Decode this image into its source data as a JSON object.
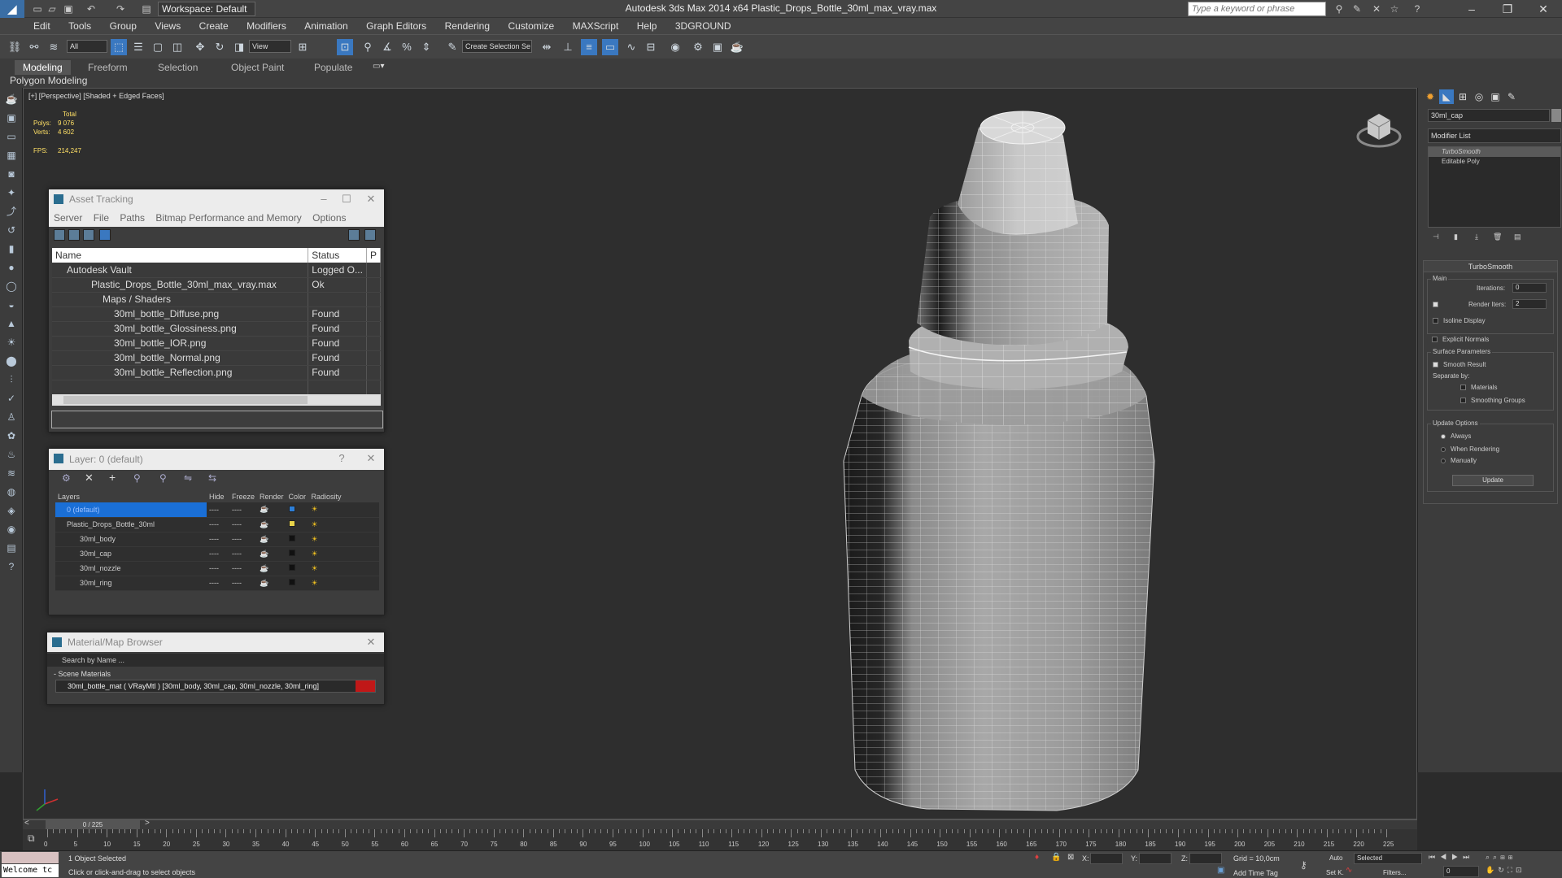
{
  "app": {
    "title": "Autodesk 3ds Max  2014 x64     Plastic_Drops_Bottle_30ml_max_vray.max",
    "workspace": "Workspace: Default",
    "search_placeholder": "Type a keyword or phrase"
  },
  "menu": [
    "Edit",
    "Tools",
    "Group",
    "Views",
    "Create",
    "Modifiers",
    "Animation",
    "Graph Editors",
    "Rendering",
    "Customize",
    "MAXScript",
    "Help",
    "3DGROUND"
  ],
  "toolbar": {
    "filter": "All",
    "view": "View",
    "named_sel": "Create Selection Se"
  },
  "ribbon": {
    "tabs": [
      "Modeling",
      "Freeform",
      "Selection",
      "Object Paint",
      "Populate"
    ],
    "active": "Modeling",
    "subtitle": "Polygon Modeling"
  },
  "viewport": {
    "label": "[+] [Perspective] [Shaded + Edged Faces]",
    "stats_total": "Total",
    "polys_label": "Polys:",
    "polys": "9 076",
    "verts_label": "Verts:",
    "verts": "4 602",
    "fps_label": "FPS:",
    "fps": "214,247"
  },
  "asset_tracking": {
    "title": "Asset Tracking",
    "menu": [
      "Server",
      "File",
      "Paths",
      "Bitmap Performance and Memory",
      "Options"
    ],
    "columns": [
      "Name",
      "Status",
      "P"
    ],
    "rows": [
      {
        "name": "Autodesk Vault",
        "status": "Logged O...",
        "indent": 0
      },
      {
        "name": "Plastic_Drops_Bottle_30ml_max_vray.max",
        "status": "Ok",
        "indent": 1
      },
      {
        "name": "Maps / Shaders",
        "status": "",
        "indent": 2
      },
      {
        "name": "30ml_bottle_Diffuse.png",
        "status": "Found",
        "indent": 3
      },
      {
        "name": "30ml_bottle_Glossiness.png",
        "status": "Found",
        "indent": 3
      },
      {
        "name": "30ml_bottle_IOR.png",
        "status": "Found",
        "indent": 3
      },
      {
        "name": "30ml_bottle_Normal.png",
        "status": "Found",
        "indent": 3
      },
      {
        "name": "30ml_bottle_Reflection.png",
        "status": "Found",
        "indent": 3
      }
    ]
  },
  "layer": {
    "title": "Layer: 0 (default)",
    "help": "?",
    "columns": [
      "Layers",
      "Hide",
      "Freeze",
      "Render",
      "Color",
      "Radiosity"
    ],
    "rows": [
      {
        "name": "0 (default)",
        "color": "#2d7fd8"
      },
      {
        "name": "Plastic_Drops_Bottle_30ml",
        "color": "#e8d34a"
      },
      {
        "name": "30ml_body",
        "color": "#111111"
      },
      {
        "name": "30ml_cap",
        "color": "#111111"
      },
      {
        "name": "30ml_nozzle",
        "color": "#111111"
      },
      {
        "name": "30ml_ring",
        "color": "#111111"
      }
    ],
    "dash": "----"
  },
  "material_browser": {
    "title": "Material/Map Browser",
    "search": "Search by Name ...",
    "section": "- Scene Materials",
    "material": "30ml_bottle_mat  ( VRayMtl ) [30ml_body, 30ml_cap, 30ml_nozzle, 30ml_ring]"
  },
  "command_panel": {
    "object_name": "30ml_cap",
    "modifier_list": "Modifier List",
    "stack": [
      "TurboSmooth",
      "Editable Poly"
    ],
    "turbosmooth": {
      "title": "TurboSmooth",
      "main": "Main",
      "iterations_label": "Iterations:",
      "iterations": "0",
      "render_iters_label": "Render Iters:",
      "render_iters": "2",
      "isoline": "Isoline Display",
      "explicit": "Explicit Normals",
      "surface": "Surface Parameters",
      "smooth_result": "Smooth Result",
      "separate_by": "Separate by:",
      "materials": "Materials",
      "smoothing_groups": "Smoothing Groups",
      "update_options": "Update Options",
      "always": "Always",
      "when_rendering": "When Rendering",
      "manually": "Manually",
      "update": "Update"
    }
  },
  "timeline": {
    "slider": "0 / 225",
    "ticks": [
      "0",
      "5",
      "10",
      "15",
      "20",
      "25",
      "30",
      "35",
      "40",
      "45",
      "50",
      "55",
      "60",
      "65",
      "70",
      "75",
      "80",
      "85",
      "90",
      "95",
      "100",
      "105",
      "110",
      "115",
      "120",
      "125",
      "130",
      "135",
      "140",
      "145",
      "150",
      "155",
      "160",
      "165",
      "170",
      "175",
      "180",
      "185",
      "190",
      "195",
      "200",
      "205",
      "210",
      "215",
      "220",
      "225"
    ]
  },
  "status": {
    "welcome": "Welcome tc",
    "selected": "1 Object Selected",
    "prompt": "Click or click-and-drag to select objects",
    "x_label": "X:",
    "y_label": "Y:",
    "z_label": "Z:",
    "grid": "Grid = 10,0cm",
    "add_time_tag": "Add Time Tag",
    "auto": "Auto",
    "set_key": "Set K.",
    "selected_dd": "Selected",
    "filters": "Filters...",
    "frame": "0"
  }
}
